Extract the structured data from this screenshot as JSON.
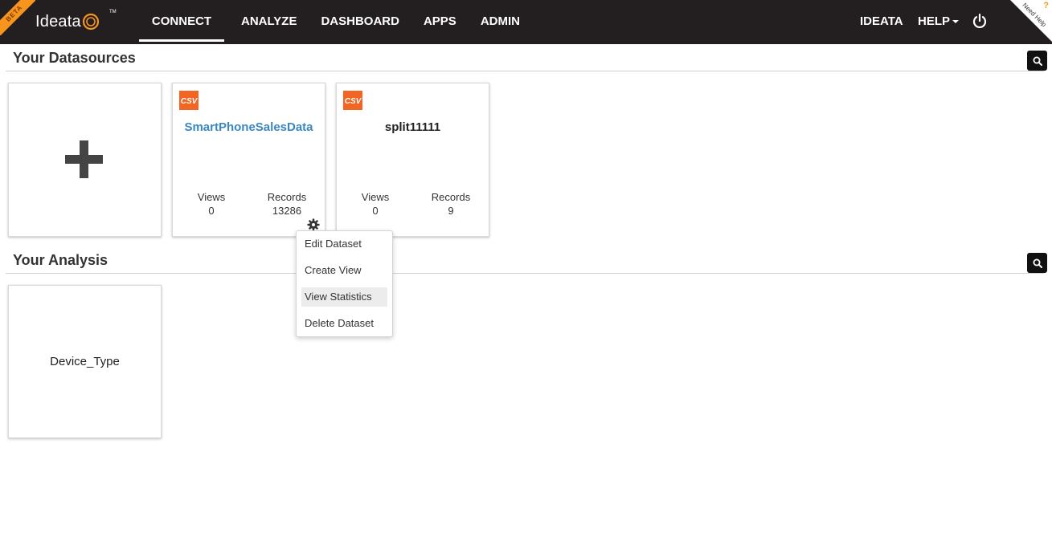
{
  "header": {
    "beta_label": "BETA",
    "brand": "Ideata",
    "brand_tm": "TM",
    "nav": [
      {
        "label": "CONNECT",
        "active": true
      },
      {
        "label": "ANALYZE",
        "active": false
      },
      {
        "label": "DASHBOARD",
        "active": false
      },
      {
        "label": "APPS",
        "active": false
      },
      {
        "label": "ADMIN",
        "active": false
      }
    ],
    "user_label": "IDEATA",
    "help_label": "HELP",
    "need_help": "Need Help"
  },
  "datasources": {
    "title": "Your Datasources",
    "cards": [
      {
        "name": "SmartPhoneSalesData",
        "type": "CSV",
        "views_label": "Views",
        "views": "0",
        "records_label": "Records",
        "records": "13286"
      },
      {
        "name": "split11111",
        "type": "CSV",
        "views_label": "Views",
        "views": "0",
        "records_label": "Records",
        "records": "9"
      }
    ]
  },
  "context_menu": {
    "items": [
      "Edit Dataset",
      "Create View",
      "View Statistics",
      "Delete Dataset"
    ],
    "highlighted": "View Statistics"
  },
  "analysis": {
    "title": "Your Analysis",
    "cards": [
      {
        "name": "Device_Type"
      }
    ]
  },
  "colors": {
    "navbar": "#231f20",
    "accent_orange": "#f7941d",
    "csv_orange": "#f26522",
    "link_blue": "#3a87c2"
  }
}
